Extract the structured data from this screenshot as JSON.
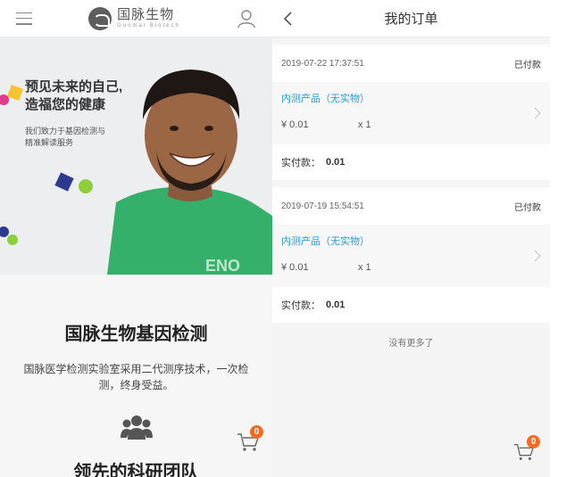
{
  "left": {
    "header": {
      "logo_cn": "国脉生物",
      "logo_en": "Guomai Biotech"
    },
    "hero": {
      "title_line1": "预见未来的自己,",
      "title_line2": "造福您的健康",
      "sub_line1": "我们致力于基因检测与",
      "sub_line2": "精准解读服务"
    },
    "intro": {
      "title": "国脉生物基因检测",
      "desc": "国脉医学检测实验室采用二代测序技术，一次检测，终身受益。",
      "team_title": "领先的科研团队"
    },
    "cart_count": "0"
  },
  "right": {
    "header": {
      "title": "我的订单"
    },
    "orders": [
      {
        "datetime": "2019-07-22 17:37:51",
        "status": "已付款",
        "product": "内测产品（无实物）",
        "price": "¥ 0.01",
        "qty": "x 1",
        "paid_label": "实付款：",
        "paid_value": "0.01"
      },
      {
        "datetime": "2019-07-19 15:54:51",
        "status": "已付款",
        "product": "内测产品（无实物）",
        "price": "¥ 0.01",
        "qty": "x 1",
        "paid_label": "实付款：",
        "paid_value": "0.01"
      }
    ],
    "no_more": "没有更多了",
    "cart_count": "0"
  },
  "colors": {
    "accent_blue": "#2d9ad8",
    "badge_orange": "#f26b21",
    "shirt_green": "#35b06a"
  }
}
